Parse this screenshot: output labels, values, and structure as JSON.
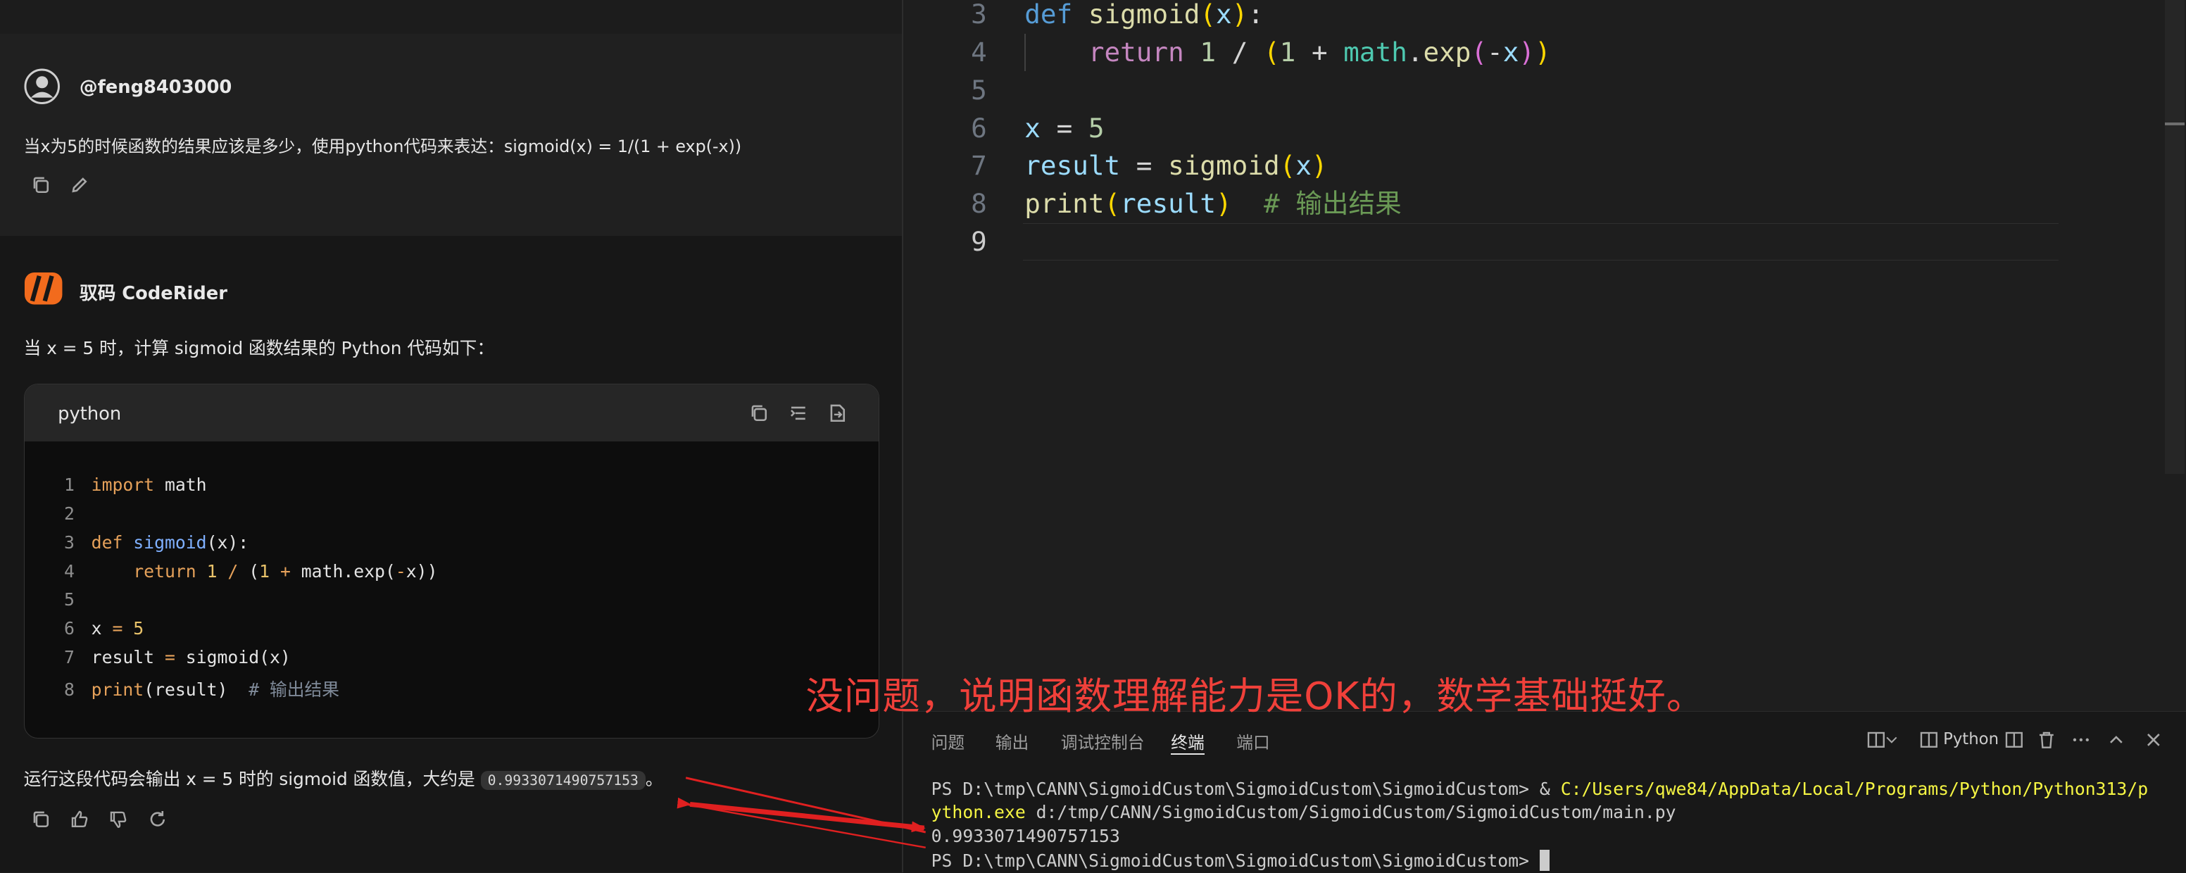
{
  "chat": {
    "user_name": "@feng8403000",
    "user_message": "当x为5的时候函数的结果应该是多少，使用python代码来表达：sigmoid(x) = 1/(1 + exp(-x))",
    "bot_name": "驭码 CodeRider",
    "bot_intro": "当 x = 5 时，计算 sigmoid 函数结果的 Python 代码如下：",
    "code_language": "python",
    "code_lines": [
      {
        "n": "1",
        "text": "import math"
      },
      {
        "n": "2",
        "text": ""
      },
      {
        "n": "3",
        "text": "def sigmoid(x):"
      },
      {
        "n": "4",
        "text": "    return 1 / (1 + math.exp(-x))"
      },
      {
        "n": "5",
        "text": ""
      },
      {
        "n": "6",
        "text": "x = 5"
      },
      {
        "n": "7",
        "text": "result = sigmoid(x)"
      },
      {
        "n": "8",
        "text": "print(result)  # 输出结果"
      }
    ],
    "result_prefix": "运行这段代码会输出 x = 5 时的 sigmoid 函数值，大约是",
    "result_value": "0.9933071490757153",
    "result_suffix": "。"
  },
  "editor": {
    "lines": [
      {
        "n": "3",
        "text": "def sigmoid(x):"
      },
      {
        "n": "4",
        "text": "    return 1 / (1 + math.exp(-x))"
      },
      {
        "n": "5",
        "text": ""
      },
      {
        "n": "6",
        "text": "x = 5"
      },
      {
        "n": "7",
        "text": "result = sigmoid(x)"
      },
      {
        "n": "8",
        "text": "print(result)  # 输出结果"
      },
      {
        "n": "9",
        "text": ""
      }
    ]
  },
  "terminal": {
    "tabs": [
      "问题",
      "输出",
      "调试控制台",
      "终端",
      "端口"
    ],
    "active_tab": "终端",
    "profile_label": "Python",
    "prompt1": "PS D:\\tmp\\CANN\\SigmoidCustom\\SigmoidCustom\\SigmoidCustom> ",
    "command_amp": "& ",
    "command_exe_part1": "C:/Users/qwe84/AppData/Local/Programs/Python/Python313/p",
    "command_exe_part2": "ython.exe",
    "command_args": " d:/tmp/CANN/SigmoidCustom/SigmoidCustom/SigmoidCustom/main.py",
    "output": "0.9933071490757153",
    "prompt2": "PS D:\\tmp\\CANN\\SigmoidCustom\\SigmoidCustom\\SigmoidCustom> "
  },
  "annotation": "没问题，说明函数理解能力是OK的，数学基础挺好。",
  "colors": {
    "annotation": "#f0403a",
    "arrow": "#e02020",
    "terminal_path": "#f5f543",
    "logo": "#f26b1d"
  },
  "icons": [
    "user-avatar-icon",
    "copy-icon",
    "edit-icon",
    "coderider-logo-icon",
    "wrap-icon",
    "insert-icon",
    "like-icon",
    "dislike-icon",
    "refresh-icon",
    "split-icon",
    "chevron-down-icon",
    "trash-icon",
    "more-icon",
    "chevron-up-icon",
    "close-icon"
  ]
}
